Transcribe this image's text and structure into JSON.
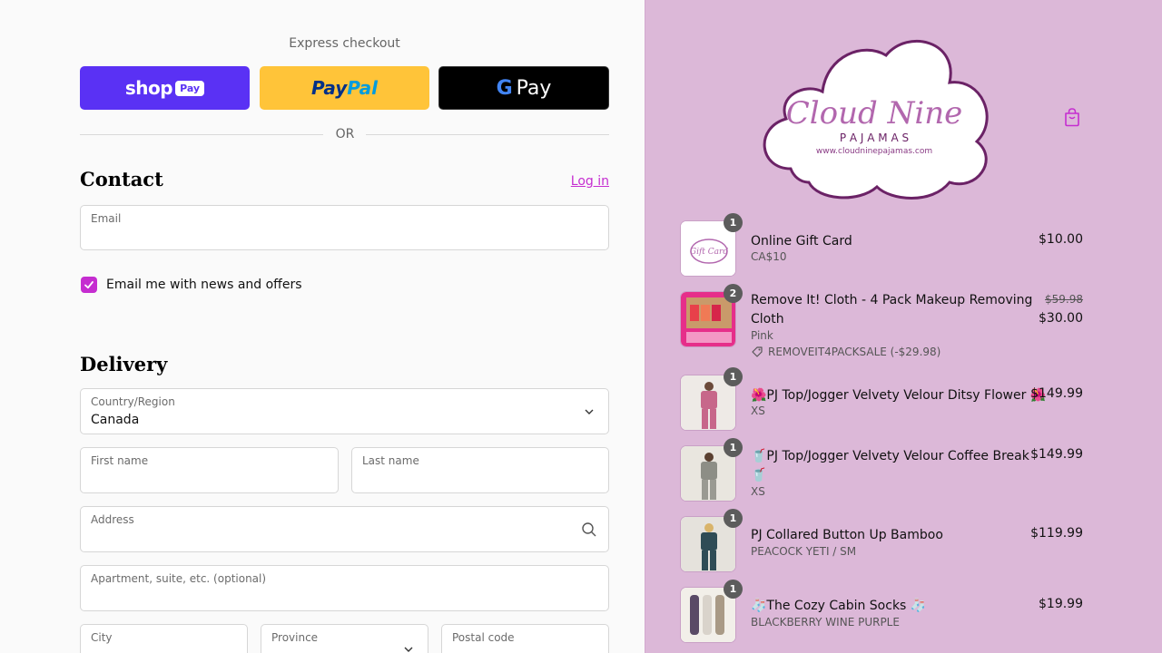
{
  "express": {
    "label": "Express checkout",
    "shop_word": "shop",
    "shop_pay": "Pay",
    "paypal_a": "Pay",
    "paypal_b": "Pal",
    "gpay_g": "G",
    "gpay_word": "Pay",
    "or": "OR"
  },
  "contact": {
    "heading": "Contact",
    "login": "Log in",
    "email_label": "Email",
    "newsletter_label": "Email me with news and offers",
    "newsletter_checked": true
  },
  "delivery": {
    "heading": "Delivery",
    "country_label": "Country/Region",
    "country_value": "Canada",
    "first_name_label": "First name",
    "last_name_label": "Last name",
    "address_label": "Address",
    "apartment_label": "Apartment, suite, etc. (optional)",
    "city_label": "City",
    "province_label": "Province",
    "postal_label": "Postal code"
  },
  "brand": {
    "name_line1": "Cloud Nine",
    "name_line2": "P A J A M A S",
    "url": "www.cloudninepajamas.com",
    "gift_card_text": "Gift Card",
    "accent": "#c52dd0",
    "panel_bg": "#dcb8d8"
  },
  "cart": {
    "items": [
      {
        "qty": "1",
        "name": "Online Gift Card",
        "sub": "CA$10",
        "price": "$10.00"
      },
      {
        "qty": "2",
        "name_line1": "Remove It! Cloth - 4 Pack Makeup Removing",
        "name_line2": "Cloth",
        "sub": "Pink",
        "old_price": "$59.98",
        "price": "$30.00",
        "discount": "REMOVEIT4PACKSALE (-$29.98)"
      },
      {
        "qty": "1",
        "name": "🌺PJ Top/Jogger Velvety Velour Ditsy Flower 🌺",
        "sub": "XS",
        "price": "$149.99"
      },
      {
        "qty": "1",
        "name_line1": "🥤PJ Top/Jogger Velvety Velour Coffee Break",
        "name_line2": "🥤",
        "sub": "XS",
        "price": "$149.99"
      },
      {
        "qty": "1",
        "name": "PJ Collared Button Up Bamboo",
        "sub": "PEACOCK YETI / SM",
        "price": "$119.99"
      },
      {
        "qty": "1",
        "name": "🧦The Cozy Cabin Socks 🧦",
        "sub": "BLACKBERRY WINE PURPLE",
        "price": "$19.99"
      }
    ]
  }
}
